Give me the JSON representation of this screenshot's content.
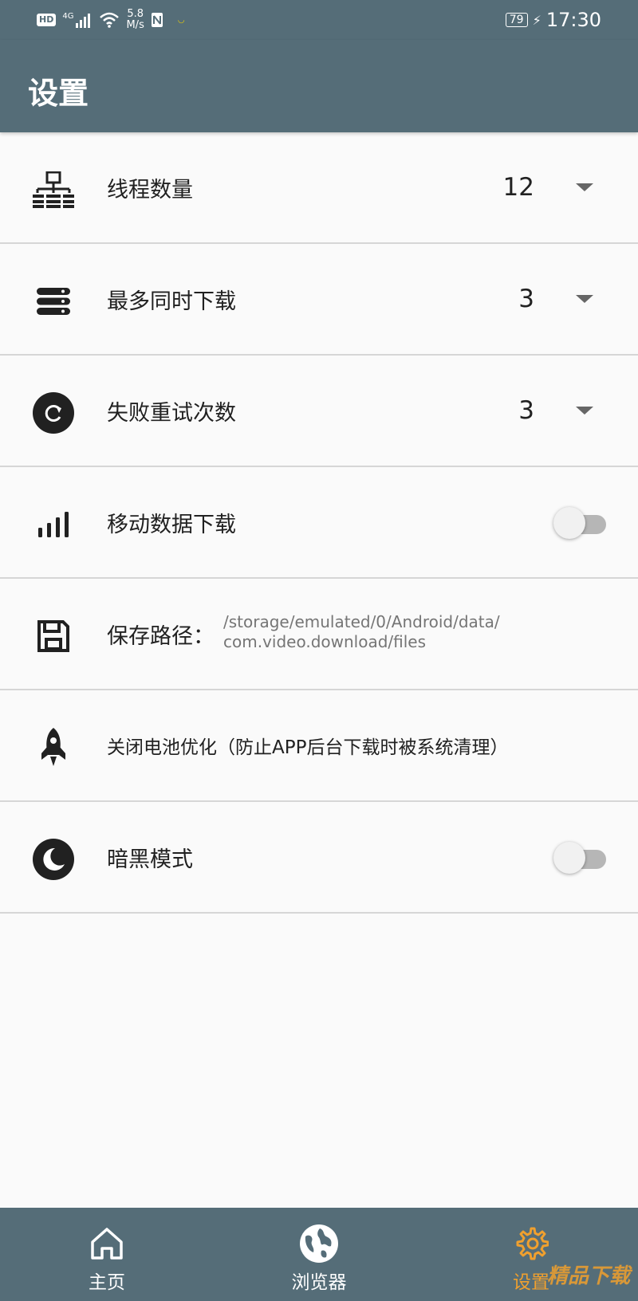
{
  "status_bar": {
    "hd": "HD",
    "network": "4G",
    "speed_value": "5.8",
    "speed_unit": "M/s",
    "battery": "79",
    "time": "17:30"
  },
  "app_bar": {
    "title": "设置"
  },
  "settings": {
    "threads": {
      "label": "线程数量",
      "value": "12",
      "icon": "network-tree-icon"
    },
    "max_downloads": {
      "label": "最多同时下载",
      "value": "3",
      "icon": "stack-icon"
    },
    "retry": {
      "label": "失败重试次数",
      "value": "3",
      "icon": "refresh-icon"
    },
    "mobile_data": {
      "label": "移动数据下载",
      "enabled": false,
      "icon": "signal-bars-icon"
    },
    "save_path": {
      "label": "保存路径：",
      "path_line1": "/storage/emulated/0/Android/data/",
      "path_line2": "com.video.download/files",
      "icon": "floppy-disk-icon"
    },
    "battery_opt": {
      "label": "关闭电池优化（防止APP后台下载时被系统清理）",
      "icon": "rocket-icon"
    },
    "dark_mode": {
      "label": "暗黑模式",
      "enabled": false,
      "icon": "moon-icon"
    }
  },
  "bottom_nav": {
    "items": [
      {
        "label": "主页",
        "icon": "home-icon"
      },
      {
        "label": "浏览器",
        "icon": "globe-icon"
      },
      {
        "label": "设置",
        "icon": "gear-icon"
      }
    ],
    "active_color": "#f0a02e"
  },
  "watermark": "精品下载",
  "colors": {
    "bar": "#556d78",
    "background": "#fafafa",
    "divider": "#d6d6d6"
  }
}
